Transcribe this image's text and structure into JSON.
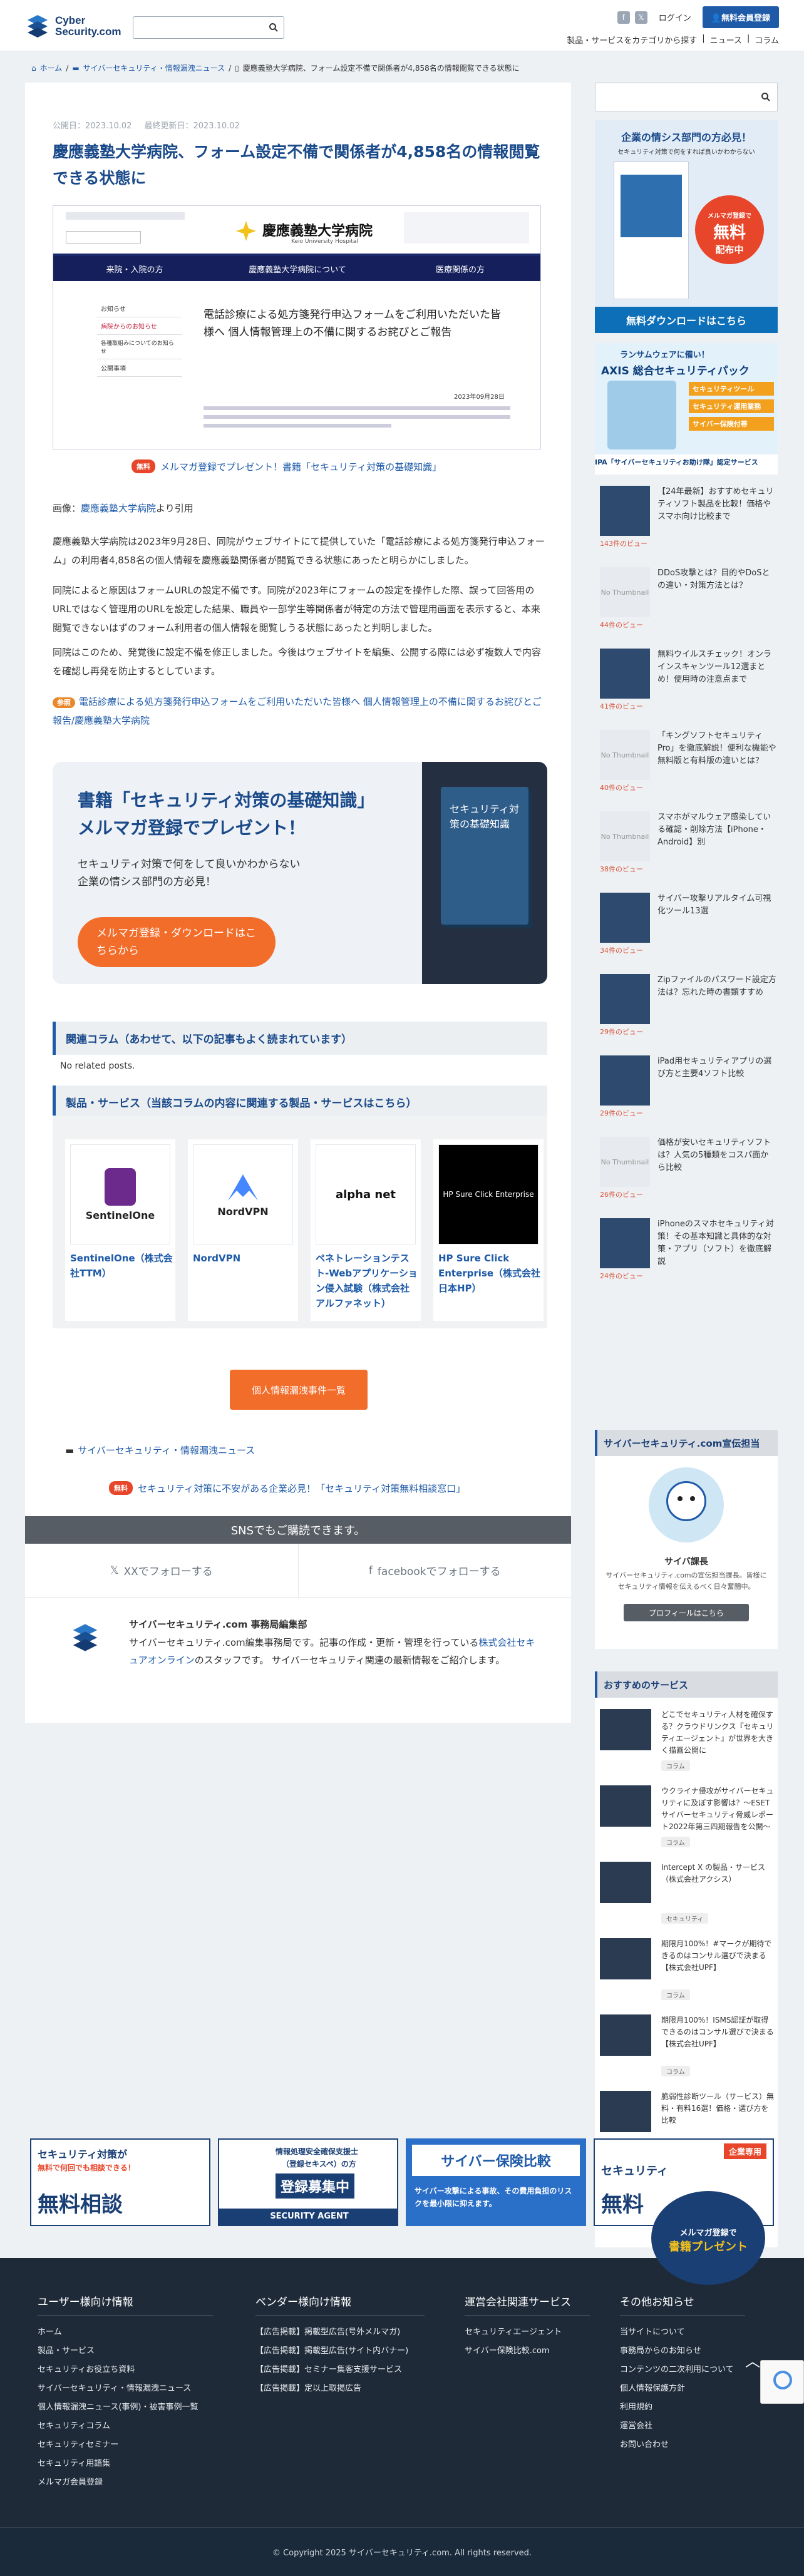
{
  "header": {
    "logo_line1": "Cyber",
    "logo_line2": "Security.com",
    "login": "ログイン",
    "register": "無料会員登録",
    "nav": [
      "製品・サービスをカテゴリから探す",
      "|",
      "ニュース",
      "|",
      "コラム"
    ]
  },
  "breadcrumb": [
    "ホーム",
    "サイバーセキュリティ・情報漏洩ニュース",
    "慶應義塾大学病院、フォーム設定不備で関係者が4,858名の情報閲覧できる状態に"
  ],
  "article": {
    "published": "公開日：2023.10.02",
    "updated": "最終更新日：2023.10.02",
    "title": "慶應義塾大学病院、フォーム設定不備で関係者が4,858名の情報閲覧できる状態に",
    "hero": {
      "hospital": "慶應義塾大学病院",
      "hospital_en": "Keio University Hospital",
      "nav": [
        "来院・入院の方",
        "慶應義塾大学病院について",
        "医療関係の方"
      ],
      "menu": [
        "お知らせ",
        "病院からのお知らせ",
        "各種取組みについてのお知らせ",
        "公開事項"
      ],
      "heading": "電話診療による処方箋発行申込フォームをご利用いただいた皆様へ 個人情報管理上の不備に関するお詫びとご報告",
      "date": "2023年09月28日"
    },
    "promo1_badge": "無料",
    "promo1": "メルマガ登録でプレゼント！書籍「セキュリティ対策の基礎知識」",
    "source_prefix": "画像：",
    "source_link": "慶應義塾大学病院",
    "source_suffix": "より引用",
    "p1": "慶應義塾大学病院は2023年9月28日、同院がウェブサイトにて提供していた「電話診療による処方箋発行申込フォーム」の利用者4,858名の個人情報を慶應義塾関係者が閲覧できる状態にあったと明らかにしました。",
    "p2": "同院によると原因はフォームURLの設定不備です。同院が2023年にフォームの設定を操作した際、誤って回答用のURLではなく管理用のURLを設定した結果、職員や一部学生等関係者が特定の方法で管理用画面を表示すると、本来閲覧できないはずのフォーム利用者の個人情報を閲覧しうる状態にあったと判明しました。",
    "p3": "同院はこのため、発覚後に設定不備を修正しました。今後はウェブサイトを編集、公開する際には必ず複数人で内容を確認し再発を防止するとしています。",
    "ref_badge": "参照",
    "ref": "電話診療による処方箋発行申込フォームをご利用いただいた皆様へ 個人情報管理上の不備に関するお詫びとご報告/慶應義塾大学病院",
    "book_title1": "書籍「セキュリティ対策の基礎知識」",
    "book_title2": "メルマガ登録でプレゼント！",
    "book_desc1": "セキュリティ対策で何をして良いかわからない",
    "book_desc2": "企業の情シス部門の方必見！",
    "book_btn": "メルマガ登録・ダウンロードはこちらから",
    "book_cover": "セキュリティ対策の基礎知識",
    "related_heading": "関連コラム（あわせて、以下の記事もよく読まれています）",
    "no_related": "No related posts.",
    "products_heading": "製品・サービス（当該コラムの内容に関連する製品・サービスはこちら）",
    "products": [
      {
        "name": "SentinelOne（株式会社TTM）",
        "logo": "SentinelOne"
      },
      {
        "name": "NordVPN",
        "logo": "NordVPN"
      },
      {
        "name": "ペネトレーションテスト-Webアプリケーション侵入試験（株式会社アルファネット）",
        "logo": "alpha net"
      },
      {
        "name": "HP Sure Click Enterprise（株式会社 日本HP）",
        "logo": "HP Sure Click Enterprise"
      }
    ],
    "list_btn": "個人情報漏洩事件一覧",
    "category": "サイバーセキュリティ・情報漏洩ニュース",
    "promo2_badge": "無料",
    "promo2": "セキュリティ対策に不安がある企業必見！「セキュリティ対策無料相談窓口」",
    "sns_bar": "SNSでもご購読できます。",
    "sns_x": "XXでフォローする",
    "sns_fb": "facebookでフォローする",
    "author_name": "サイバーセキュリティ.com 事務局編集部",
    "author_desc_a": "サイバーセキュリティ.com編集事務局です。記事の作成・更新・管理を行っている",
    "author_link": "株式会社セキュアオンライン",
    "author_desc_b": "のスタッフです。 サイバーセキュリティ関連の最新情報をご紹介します。"
  },
  "sidebar": {
    "ad1_head": "企業の情シス部門の方必見！",
    "ad1_sub": "セキュリティ対策で何をすれば良いかわからない",
    "ad1_badge1": "メルマガ登録で",
    "ad1_badge2": "無料",
    "ad1_badge3": "配布中",
    "ad1_btn": "無料ダウンロードはこちら",
    "ad2_top": "ランサムウェアに備い！",
    "ad2_title": "AXIS 総合セキュリティパック",
    "ad2_items": [
      "セキュリティツール",
      "セキュリティ運用業務",
      "サイバー保険付帯"
    ],
    "ad2_caption": "IPA「サイバーセキュリティお助け隊」認定サービス",
    "ranking": [
      {
        "title": "【24年最新】おすすめセキュリティソフト製品を比較！価格やスマホ向け比較まで",
        "views": "143件のビュー",
        "thumb": ""
      },
      {
        "title": "DDoS攻撃とは？目的やDoSとの違い・対策方法とは？",
        "views": "44件のビュー",
        "thumb": "No Thumbnail"
      },
      {
        "title": "無料ウイルスチェック！オンラインスキャンツール12選まとめ！使用時の注意点まで",
        "views": "41件のビュー",
        "thumb": ""
      },
      {
        "title": "「キングソフトセキュリティPro」を徹底解説！便利な機能や無料版と有料版の違いとは？",
        "views": "40件のビュー",
        "thumb": "No Thumbnail"
      },
      {
        "title": "スマホがマルウェア感染している確認・削除方法【iPhone・Android】別",
        "views": "38件のビュー",
        "thumb": "No Thumbnail"
      },
      {
        "title": "サイバー攻撃リアルタイム可視化ツール13選",
        "views": "34件のビュー",
        "thumb": ""
      },
      {
        "title": "Zipファイルのパスワード設定方法は？忘れた時の書類すすめ",
        "views": "29件のビュー",
        "thumb": ""
      },
      {
        "title": "iPad用セキュリティアプリの選び方と主要4ソフト比較",
        "views": "29件のビュー",
        "thumb": ""
      },
      {
        "title": "価格が安いセキュリティソフトは？人気の5種類をコスパ面から比較",
        "views": "26件のビュー",
        "thumb": "No Thumbnail"
      },
      {
        "title": "iPhoneのスマホセキュリティ対策！その基本知識と具体的な対策・アプリ（ソフト）を徹底解説",
        "views": "24件のビュー",
        "thumb": ""
      }
    ],
    "profile_head": "サイバーセキュリティ.com宣伝担当",
    "profile_name": "サイバ課長",
    "profile_desc": "サイバーセキュリティ.comの宣伝担当課長。皆様にセキュリティ情報を伝えるべく日々奮闘中。",
    "profile_btn": "プロフィールはこちら",
    "svc_head": "おすすめのサービス",
    "services": [
      {
        "title": "どこでセキュリティ人材を確保する？クラウドリンクス『セキュリティエージェント』が世界を大きく描画公開に",
        "tag": "コラム"
      },
      {
        "title": "ウクライナ侵攻がサイバーセキュリティに及ぼす影響は？〜ESETサイバーセキュリティ脅威レポート2022年第三四期報告を公開〜",
        "tag": "コラム"
      },
      {
        "title": "Intercept X の製品・サービス（株式会社アクシス）",
        "tag": "セキュリティ"
      },
      {
        "title": "期限月100%！#マークが期待できるのはコンサル選びで決まる【株式会社UPF】",
        "tag": "コラム"
      },
      {
        "title": "期限月100%！ISMS認証が取得できるのはコンサル選びで決まる【株式会社UPF】",
        "tag": "コラム"
      },
      {
        "title": "脆弱性診断ツール（サービス）無料・有料16選！価格・選び方を比較",
        "tag": "コラム"
      }
    ]
  },
  "banners": [
    {
      "line1": "セキュリティ対策が",
      "line2": "無料で何回でも相談できる！",
      "big": "無料相談"
    },
    {
      "line1": "情報処理安全確保支援士",
      "line2": "（登録セキスペ）の方",
      "big": "登録募集中",
      "foot": "SECURITY AGENT"
    },
    {
      "line1": "サイバー保険比較",
      "line2": "サイバー攻撃による事故、その費用負担のリスクを最小限に抑えます。"
    },
    {
      "line1": "セキュリティ",
      "big": "無料",
      "top": "企業専用"
    }
  ],
  "float_ad": {
    "line1": "メルマガ登録で",
    "line2": "書籍プレゼント"
  },
  "footer": {
    "cols": [
      {
        "title": "ユーザー様向け情報",
        "items": [
          "ホーム",
          "製品・サービス",
          "セキュリティお役立ち資料",
          "サイバーセキュリティ・情報漏洩ニュース",
          "個人情報漏洩ニュース(事例)・被害事例一覧",
          "セキュリティコラム",
          "セキュリティセミナー",
          "セキュリティ用語集",
          "メルマガ会員登録"
        ]
      },
      {
        "title": "ベンダー様向け情報",
        "items": [
          "【広告掲載】掲載型広告(号外メルマガ)",
          "【広告掲載】掲載型広告(サイト内バナー)",
          "【広告掲載】セミナー集客支援サービス",
          "【広告掲載】定以上取掲広告"
        ]
      },
      {
        "title": "運営会社関連サービス",
        "items": [
          "セキュリティエージェント",
          "サイバー保険比較.com"
        ]
      },
      {
        "title": "その他お知らせ",
        "items": [
          "当サイトについて",
          "事務局からのお知らせ",
          "コンテンツの二次利用について",
          "個人情報保護方針",
          "利用規約",
          "運営会社",
          "お問い合わせ"
        ]
      }
    ],
    "copyright": "© Copyright 2025 サイバーセキュリティ.com. All rights reserved."
  },
  "colors": {
    "brand": "#1e5aa8",
    "accent": "#f26c2a",
    "badge": "#e8462a",
    "footer": "#1e2a38"
  }
}
